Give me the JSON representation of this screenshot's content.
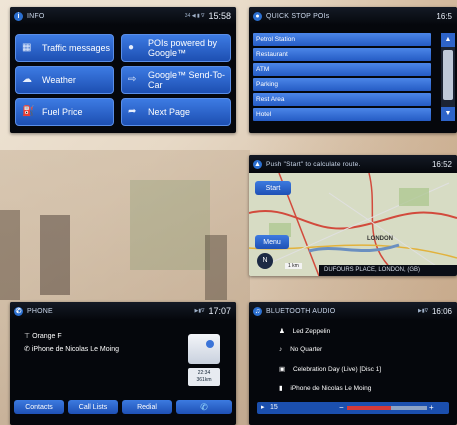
{
  "info": {
    "title": "INFO",
    "status": "34 ◀ ▮ ∇",
    "time": "15:58",
    "buttons": {
      "traffic": "Traffic messages",
      "pois": "POIs powered by Google™",
      "weather": "Weather",
      "send": "Google™ Send-To-Car",
      "fuel": "Fuel Price",
      "next": "Next Page"
    }
  },
  "quickstop": {
    "title": "QUICK STOP POIs",
    "time": "16:5",
    "items": [
      "Petrol Station",
      "Restaurant",
      "ATM",
      "Parking",
      "Rest Area",
      "Hotel"
    ]
  },
  "nav": {
    "prompt": "Push \"Start\" to calculate route.",
    "time": "16:52",
    "start": "Start",
    "menu": "Menu",
    "scale": "1 km",
    "location": "DUFOURS PLACE, LONDON, (GB)",
    "city": "LONDON",
    "compass": "N"
  },
  "phone": {
    "title": "PHONE",
    "time": "17:07",
    "line1": "Orange F",
    "line2": "iPhone de Nicolas Le Moing",
    "badge_time": "22:34",
    "badge_dist": "361km",
    "buttons": {
      "contacts": "Contacts",
      "calllists": "Call Lists",
      "redial": "Redial"
    }
  },
  "audio": {
    "title": "BLUETOOTH AUDIO",
    "time": "16:06",
    "artist": "Led Zeppelin",
    "track": "No Quarter",
    "album": "Celebration Day (Live) [Disc 1]",
    "device": "iPhone de Nicolas Le Moing",
    "volume": "15",
    "volume_level": 0.55
  }
}
